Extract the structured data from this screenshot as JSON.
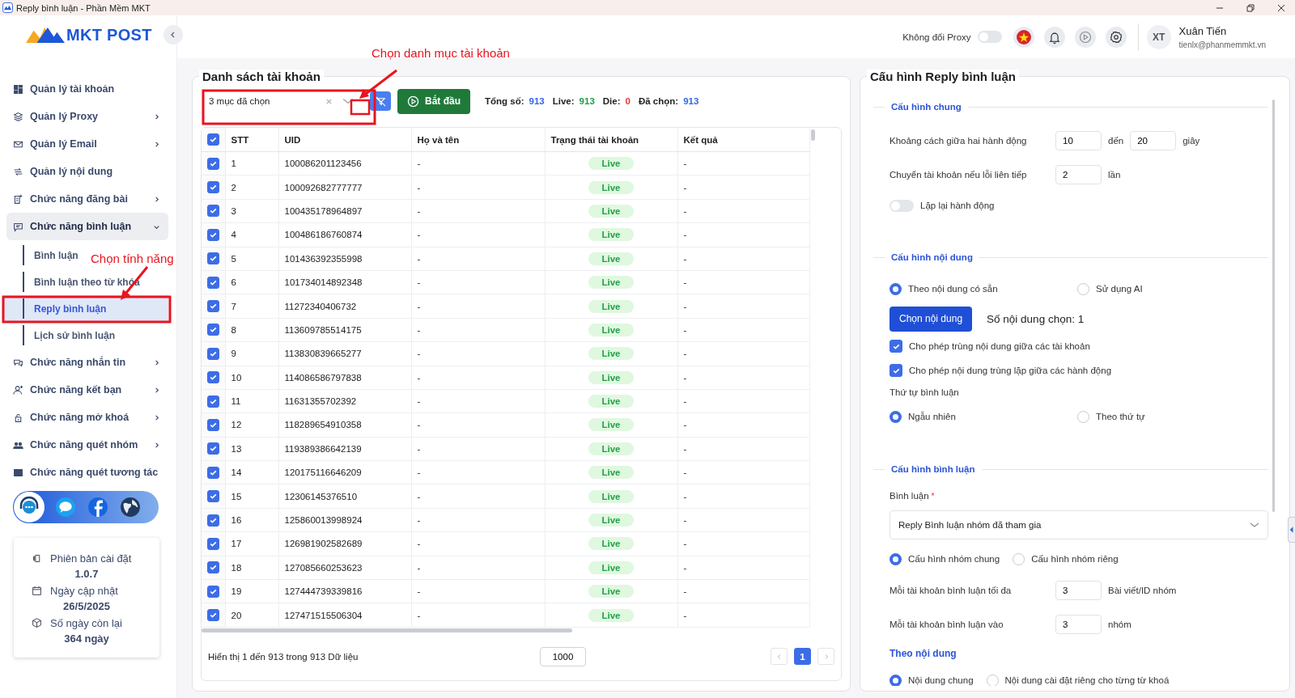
{
  "window": {
    "title": "Reply bình luận - Phần Mềm MKT"
  },
  "sidebar": {
    "brand": "MKT POST",
    "items": [
      {
        "kind": "link",
        "label": "Quản lý tài khoản"
      },
      {
        "kind": "group",
        "label": "Quản lý Proxy",
        "expanded": false
      },
      {
        "kind": "group",
        "label": "Quản lý Email",
        "expanded": false
      },
      {
        "kind": "link",
        "label": "Quản lý nội dung"
      },
      {
        "kind": "group",
        "label": "Chức năng đăng bài",
        "expanded": false
      },
      {
        "kind": "group",
        "label": "Chức năng bình luận",
        "expanded": true,
        "children": [
          {
            "label": "Bình luận",
            "selected": false
          },
          {
            "label": "Bình luận theo từ khóa",
            "selected": false
          },
          {
            "label": "Reply bình luận",
            "selected": true
          },
          {
            "label": "Lịch sử bình luận",
            "selected": false
          }
        ]
      },
      {
        "kind": "group",
        "label": "Chức năng nhắn tin",
        "expanded": false
      },
      {
        "kind": "group",
        "label": "Chức năng kết bạn",
        "expanded": false
      },
      {
        "kind": "group",
        "label": "Chức năng mở khoá",
        "expanded": false
      },
      {
        "kind": "group",
        "label": "Chức năng quét nhóm",
        "expanded": false
      },
      {
        "kind": "link",
        "label": "Chức năng quét tương tác"
      }
    ],
    "info": [
      {
        "label": "Phiên bản cài đặt",
        "value": "1.0.7"
      },
      {
        "label": "Ngày cập nhật",
        "value": "26/5/2025"
      },
      {
        "label": "Số ngày còn lại",
        "value": "364 ngày"
      }
    ]
  },
  "header": {
    "proxy_toggle": {
      "label": "Không đổi Proxy",
      "on": false
    },
    "user": {
      "initials": "XT",
      "name": "Xuân Tiến",
      "email": "tienlx@phanmemmkt.vn"
    }
  },
  "accounts": {
    "title": "Danh sách tài khoản",
    "category": {
      "value": "3 mục đã chọn"
    },
    "start_button": "Bắt đầu",
    "stats": [
      {
        "label": "Tổng số:",
        "value": "913",
        "color": "#3366ee"
      },
      {
        "label": "Live:",
        "value": "913",
        "color": "#1e9e4a"
      },
      {
        "label": "Die:",
        "value": "0",
        "color": "#ee3333"
      },
      {
        "label": "Đã chọn:",
        "value": "913",
        "color": "#3366ee"
      }
    ],
    "table": {
      "all_checked": true,
      "columns": [
        "STT",
        "UID",
        "Họ và tên",
        "Trạng thái tài khoản",
        "Kết quả"
      ],
      "rows": [
        {
          "checked": true,
          "stt": "1",
          "uid": "100086201123456",
          "name": "-",
          "status": "Live",
          "result": "-"
        },
        {
          "checked": true,
          "stt": "2",
          "uid": "100092682777777",
          "name": "-",
          "status": "Live",
          "result": "-"
        },
        {
          "checked": true,
          "stt": "3",
          "uid": "100435178964897",
          "name": "-",
          "status": "Live",
          "result": "-"
        },
        {
          "checked": true,
          "stt": "4",
          "uid": "100486186760874",
          "name": "-",
          "status": "Live",
          "result": "-"
        },
        {
          "checked": true,
          "stt": "5",
          "uid": "101436392355998",
          "name": "-",
          "status": "Live",
          "result": "-"
        },
        {
          "checked": true,
          "stt": "6",
          "uid": "101734014892348",
          "name": "-",
          "status": "Live",
          "result": "-"
        },
        {
          "checked": true,
          "stt": "7",
          "uid": "11272340406732",
          "name": "-",
          "status": "Live",
          "result": "-"
        },
        {
          "checked": true,
          "stt": "8",
          "uid": "113609785514175",
          "name": "-",
          "status": "Live",
          "result": "-"
        },
        {
          "checked": true,
          "stt": "9",
          "uid": "113830839665277",
          "name": "-",
          "status": "Live",
          "result": "-"
        },
        {
          "checked": true,
          "stt": "10",
          "uid": "114086586797838",
          "name": "-",
          "status": "Live",
          "result": "-"
        },
        {
          "checked": true,
          "stt": "11",
          "uid": "11631355702392",
          "name": "-",
          "status": "Live",
          "result": "-"
        },
        {
          "checked": true,
          "stt": "12",
          "uid": "118289654910358",
          "name": "-",
          "status": "Live",
          "result": "-"
        },
        {
          "checked": true,
          "stt": "13",
          "uid": "119389386642139",
          "name": "-",
          "status": "Live",
          "result": "-"
        },
        {
          "checked": true,
          "stt": "14",
          "uid": "120175116646209",
          "name": "-",
          "status": "Live",
          "result": "-"
        },
        {
          "checked": true,
          "stt": "15",
          "uid": "12306145376510",
          "name": "-",
          "status": "Live",
          "result": "-"
        },
        {
          "checked": true,
          "stt": "16",
          "uid": "125860013998924",
          "name": "-",
          "status": "Live",
          "result": "-"
        },
        {
          "checked": true,
          "stt": "17",
          "uid": "126981902582689",
          "name": "-",
          "status": "Live",
          "result": "-"
        },
        {
          "checked": true,
          "stt": "18",
          "uid": "127085660253623",
          "name": "-",
          "status": "Live",
          "result": "-"
        },
        {
          "checked": true,
          "stt": "19",
          "uid": "127444739339816",
          "name": "-",
          "status": "Live",
          "result": "-"
        },
        {
          "checked": true,
          "stt": "20",
          "uid": "127471515506304",
          "name": "-",
          "status": "Live",
          "result": "-"
        }
      ]
    },
    "footer": {
      "summary": "Hiển thị 1 đến 913 trong 913 Dữ liệu",
      "page_size": "1000",
      "pages": [
        {
          "label": "1",
          "selected": true
        }
      ]
    }
  },
  "settings": {
    "title": "Cấu hình Reply bình luận",
    "sections": [
      {
        "heading": "Cấu hình chung",
        "items": [
          {
            "kind": "range",
            "label": "Khoảng cách giữa hai hành động",
            "from": "10",
            "joiner": "đến",
            "to": "20",
            "unit": "giây"
          },
          {
            "kind": "number",
            "label": "Chuyển tài khoản nếu lỗi liên tiếp",
            "value": "2",
            "unit": "lần"
          },
          {
            "kind": "toggle",
            "label": "Lặp lại hành động",
            "on": false
          }
        ]
      },
      {
        "heading": "Cấu hình nội dung",
        "items": [
          {
            "kind": "radios",
            "compact": false,
            "options": [
              {
                "label": "Theo nội dung có sẵn",
                "selected": true
              },
              {
                "label": "Sử dụng AI",
                "selected": false
              }
            ]
          },
          {
            "kind": "action",
            "button": "Chọn nội dung",
            "note": "Số nội dung chọn: 1"
          },
          {
            "kind": "checkbox",
            "label": "Cho phép trùng nội dung giữa các tài khoản",
            "checked": true
          },
          {
            "kind": "checkbox",
            "label": "Cho phép nội dung trùng lặp giữa các hành động",
            "checked": true
          },
          {
            "kind": "caption",
            "text": "Thứ tự bình luận"
          },
          {
            "kind": "radios",
            "compact": false,
            "options": [
              {
                "label": "Ngẫu nhiên",
                "selected": true
              },
              {
                "label": "Theo thứ tự",
                "selected": false
              }
            ]
          }
        ]
      },
      {
        "heading": "Cấu hình bình luận",
        "items": [
          {
            "kind": "caption",
            "text": "Bình luận",
            "required_mark": "*"
          },
          {
            "kind": "select",
            "value": "Reply Bình luận nhóm đã tham gia"
          },
          {
            "kind": "radios",
            "compact": true,
            "options": [
              {
                "label": "Cấu hình nhóm chung",
                "selected": true
              },
              {
                "label": "Cấu hình nhóm riêng",
                "selected": false
              }
            ]
          },
          {
            "kind": "number",
            "label": "Mỗi tài khoản bình luận tối đa",
            "value": "3",
            "unit": "Bài viết/ID nhóm"
          },
          {
            "kind": "number",
            "label": "Mỗi tài khoản bình luận vào",
            "value": "3",
            "unit": "nhóm"
          },
          {
            "kind": "subheading",
            "text": "Theo nội dung"
          },
          {
            "kind": "radios",
            "compact": true,
            "options": [
              {
                "label": "Nội dung chung",
                "selected": true
              },
              {
                "label": "Nội dung cài đặt riêng cho từng từ khoá",
                "selected": false
              }
            ]
          }
        ]
      }
    ]
  },
  "annotations": [
    {
      "text": "Chọn danh mục tài khoản"
    },
    {
      "text": "Chọn tính năng"
    }
  ]
}
